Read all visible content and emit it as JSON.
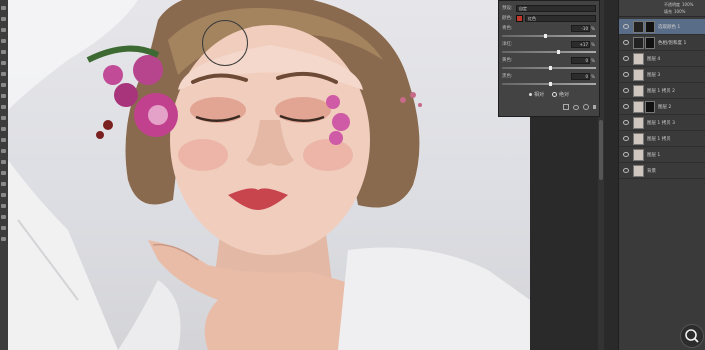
{
  "properties_panel": {
    "row1_label": "预设:",
    "row1_value": "自定",
    "row2_label": "颜色:",
    "row2_value": "红色",
    "sliders": [
      {
        "label": "青色:",
        "value": "-10",
        "fraction": 0.45
      },
      {
        "label": "洋红:",
        "value": "+17",
        "fraction": 0.58
      },
      {
        "label": "黄色:",
        "value": "0",
        "fraction": 0.5
      },
      {
        "label": "黑色:",
        "value": "0",
        "fraction": 0.5
      }
    ],
    "percent": "%",
    "mode_relative": "相对",
    "mode_absolute": "绝对"
  },
  "layers_panel": {
    "opacity_label": "不透明度",
    "opacity_value": "100%",
    "fill_label": "填充",
    "fill_value": "100%",
    "layers": [
      {
        "name": "选取颜色 1",
        "type": "adjustment",
        "selected": true
      },
      {
        "name": "色相/饱和度 1",
        "type": "adjustment"
      },
      {
        "name": "图层 4",
        "type": "pixel"
      },
      {
        "name": "图层 3",
        "type": "pixel"
      },
      {
        "name": "图层 1 拷贝 2",
        "type": "pixel"
      },
      {
        "name": "图层 2",
        "type": "masked"
      },
      {
        "name": "图层 1 拷贝 3",
        "type": "pixel"
      },
      {
        "name": "图层 1 拷贝",
        "type": "pixel"
      },
      {
        "name": "图层 1",
        "type": "pixel"
      },
      {
        "name": "背景",
        "type": "pixel"
      }
    ]
  },
  "icons": [
    "search-icon",
    "eye-icon",
    "brush-cursor"
  ]
}
